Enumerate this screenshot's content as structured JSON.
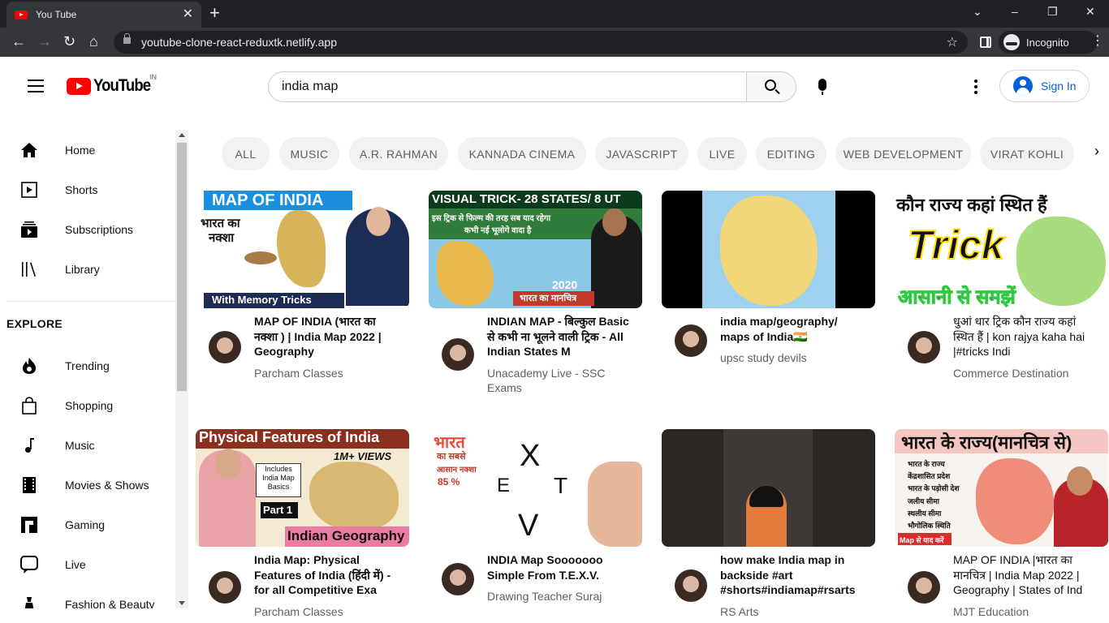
{
  "browser": {
    "tab_title": "You Tube",
    "new_tab": "+",
    "url": "youtube-clone-react-reduxtk.netlify.app",
    "incognito_label": "Incognito",
    "window_controls": [
      "⌄",
      "–",
      "❐",
      "✕"
    ]
  },
  "header": {
    "logo_text": "YouTube",
    "logo_country": "IN",
    "search_value": "india map",
    "signin_label": "Sign In"
  },
  "sidebar": {
    "main": [
      {
        "label": "Home",
        "icon": "home-icon"
      },
      {
        "label": "Shorts",
        "icon": "shorts-icon"
      },
      {
        "label": "Subscriptions",
        "icon": "subscriptions-icon"
      },
      {
        "label": "Library",
        "icon": "library-icon"
      }
    ],
    "explore_heading": "EXPLORE",
    "explore": [
      {
        "label": "Trending",
        "icon": "trending-icon"
      },
      {
        "label": "Shopping",
        "icon": "shopping-icon"
      },
      {
        "label": "Music",
        "icon": "music-icon"
      },
      {
        "label": "Movies & Shows",
        "icon": "movies-icon"
      },
      {
        "label": "Gaming",
        "icon": "gaming-icon"
      },
      {
        "label": "Live",
        "icon": "live-icon"
      },
      {
        "label": "Fashion & Beauty",
        "icon": "fashion-icon"
      }
    ]
  },
  "chips": [
    "ALL",
    "MUSIC",
    "A.R. RAHMAN",
    "KANNADA CINEMA",
    "JAVASCRIPT",
    "LIVE",
    "EDITING",
    "WEB DEVELOPMENT",
    "VIRAT KOHLI"
  ],
  "videos": [
    {
      "title": "MAP OF INDIA (भारत का नक्शा ) | India Map 2022 | Geography",
      "channel": "Parcham Classes",
      "thumb_text": [
        "MAP OF INDIA",
        "भारत का",
        "नक्शा",
        "With Memory Tricks"
      ]
    },
    {
      "title": "INDIAN MAP - बिल्कुल Basic से कभी ना भूलने वाली ट्रिक - All Indian States M",
      "channel": "Unacademy Live - SSC Exams",
      "thumb_text": [
        "VISUAL TRICK- 28 STATES/ 8 UT",
        "इस ट्रिक से फिल्म की तरह सब याद रहेगा",
        "कभी नई भूलोगे वादा है",
        "2020",
        "भारत का मानचित्र"
      ]
    },
    {
      "title": "india map/geography/ maps of India🇮🇳",
      "channel": "upsc study devils",
      "thumb_text": []
    },
    {
      "title": "धुआं धार ट्रिक कौन राज्य कहां स्थित हैं | kon rajya kaha hai |#tricks Indi",
      "channel": "Commerce Destination",
      "thumb_text": [
        "कौन राज्य कहां स्थित हैं",
        "Trick",
        "आसानी से समझें"
      ]
    },
    {
      "title": "India Map: Physical Features of India (हिंदी में) - for all Competitive Exa",
      "channel": "Parcham Classes",
      "thumb_text": [
        "Physical Features of India",
        "1M+ VIEWS",
        "Includes India Map Basics",
        "Part 1",
        "Indian Geography"
      ]
    },
    {
      "title": "INDIA Map Sooooooo Simple From T.E.X.V.",
      "channel": "Drawing Teacher Suraj",
      "thumb_text": [
        "भारत",
        "का सबसे",
        "आसान नक्शा",
        "85 %",
        "X",
        "E",
        "T",
        "V"
      ]
    },
    {
      "title": "how make India map in backside #art #shorts#indiamap#rsarts",
      "channel": "RS Arts",
      "thumb_text": []
    },
    {
      "title": "MAP OF INDIA |भारत का मानचित्र | India Map 2022 | Geography | States of Ind",
      "channel": "MJT Education",
      "thumb_text": [
        "भारत के राज्य(मानचित्र से)",
        "भारत के राज्य",
        "केंद्रशासित प्रदेश",
        "भारत के पड़ोसी देश",
        "जलीय सीमा",
        "स्थलीय सीमा",
        "भौगोलिक स्थिति",
        "Map से याद करें"
      ]
    }
  ]
}
